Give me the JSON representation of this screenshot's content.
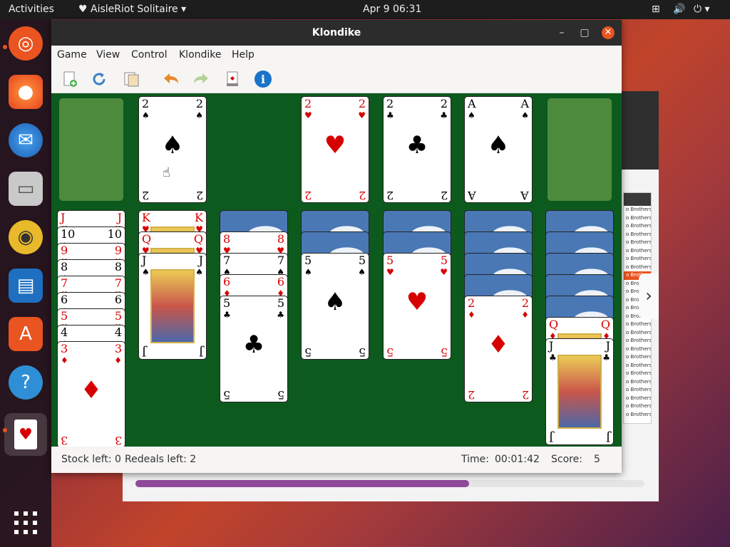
{
  "topbar": {
    "activities": "Activities",
    "app_name": "AisleRiot Solitaire",
    "datetime": "Apr 9  06:31"
  },
  "dock": {
    "icons": [
      "ubuntu-icon",
      "firefox-icon",
      "thunderbird-icon",
      "files-icon",
      "rhythmbox-icon",
      "writer-icon",
      "software-icon",
      "help-icon",
      "aisleriot-icon",
      "show-apps-icon"
    ]
  },
  "window": {
    "title": "Klondike",
    "menu": [
      "Game",
      "View",
      "Control",
      "Klondike",
      "Help"
    ],
    "toolbar": [
      "new-game-icon",
      "restart-icon",
      "select-game-icon",
      "undo-icon",
      "redo-icon",
      "hint-icon",
      "info-icon"
    ]
  },
  "tableau": {
    "foundations": [
      "2♠",
      "2♥",
      "2♣",
      "A♠"
    ],
    "columns": [
      {
        "faceup": [
          "J♥",
          "10♠",
          "9♥",
          "8♠",
          "7♥",
          "6♠",
          "5♥",
          "4♠",
          "3♦"
        ],
        "facedown": 0
      },
      {
        "faceup": [
          "K♥",
          "Q♥",
          "J♠"
        ],
        "facedown": 0
      },
      {
        "faceup": [
          "8♥",
          "7♠",
          "6♦",
          "5♣"
        ],
        "facedown": 1
      },
      {
        "faceup": [
          "5♠"
        ],
        "facedown": 2
      },
      {
        "faceup": [
          "5♥"
        ],
        "facedown": 2
      },
      {
        "faceup": [
          "2♦"
        ],
        "facedown": 4
      },
      {
        "faceup": [
          "Q♦",
          "J♣"
        ],
        "facedown": 5
      }
    ]
  },
  "status": {
    "stock": "Stock left: 0",
    "redeals": "Redeals left: 2",
    "time_label": "Time:",
    "time": "00:01:42",
    "score_label": "Score:",
    "score": "5"
  },
  "bg_list_item": "o Brothers",
  "colors": {
    "felt": "#0d5a1e",
    "slot": "#4e8a3c",
    "card_back": "#4a78b5",
    "accent": "#e95420"
  }
}
